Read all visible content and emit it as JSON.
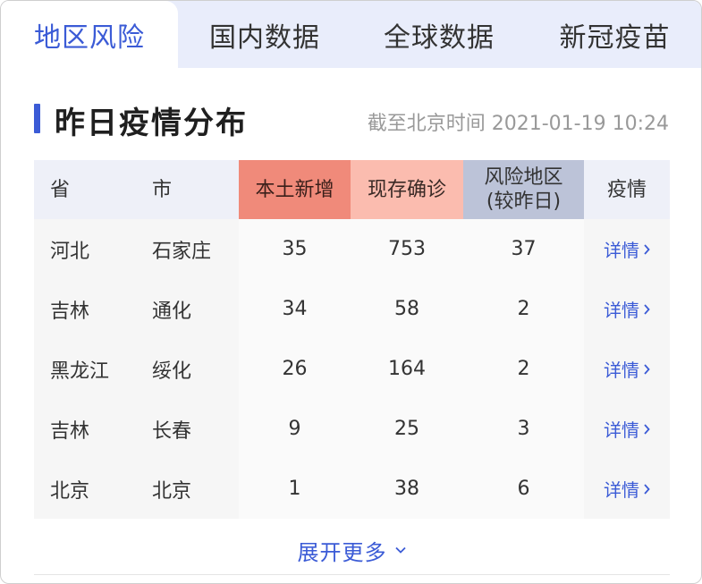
{
  "tabs": [
    {
      "label": "地区风险",
      "active": true
    },
    {
      "label": "国内数据",
      "active": false
    },
    {
      "label": "全球数据",
      "active": false
    },
    {
      "label": "新冠疫苗",
      "active": false
    }
  ],
  "section": {
    "title": "昨日疫情分布",
    "timestamp": "截至北京时间 2021-01-19 10:24"
  },
  "table": {
    "headers": {
      "province": "省",
      "city": "市",
      "new_local": "本土新增",
      "existing_confirmed": "现存确诊",
      "risk_area_line1": "风险地区",
      "risk_area_line2": "(较昨日)",
      "detail": "疫情"
    },
    "rows": [
      {
        "province": "河北",
        "city": "石家庄",
        "new_local": "35",
        "existing": "753",
        "risk": "37",
        "detail": "详情"
      },
      {
        "province": "吉林",
        "city": "通化",
        "new_local": "34",
        "existing": "58",
        "risk": "2",
        "detail": "详情"
      },
      {
        "province": "黑龙江",
        "city": "绥化",
        "new_local": "26",
        "existing": "164",
        "risk": "2",
        "detail": "详情"
      },
      {
        "province": "吉林",
        "city": "长春",
        "new_local": "9",
        "existing": "25",
        "risk": "3",
        "detail": "详情"
      },
      {
        "province": "北京",
        "city": "北京",
        "new_local": "1",
        "existing": "38",
        "risk": "6",
        "detail": "详情"
      }
    ]
  },
  "expand": {
    "label": "展开更多",
    "icon": "chevron-down-icon"
  },
  "colors": {
    "accent": "#3b5bd6",
    "new_local_header": "#f08a7a",
    "existing_header": "#fbbcaf",
    "risk_header": "#bcc3d8",
    "tab_bar": "#e9edfb"
  }
}
